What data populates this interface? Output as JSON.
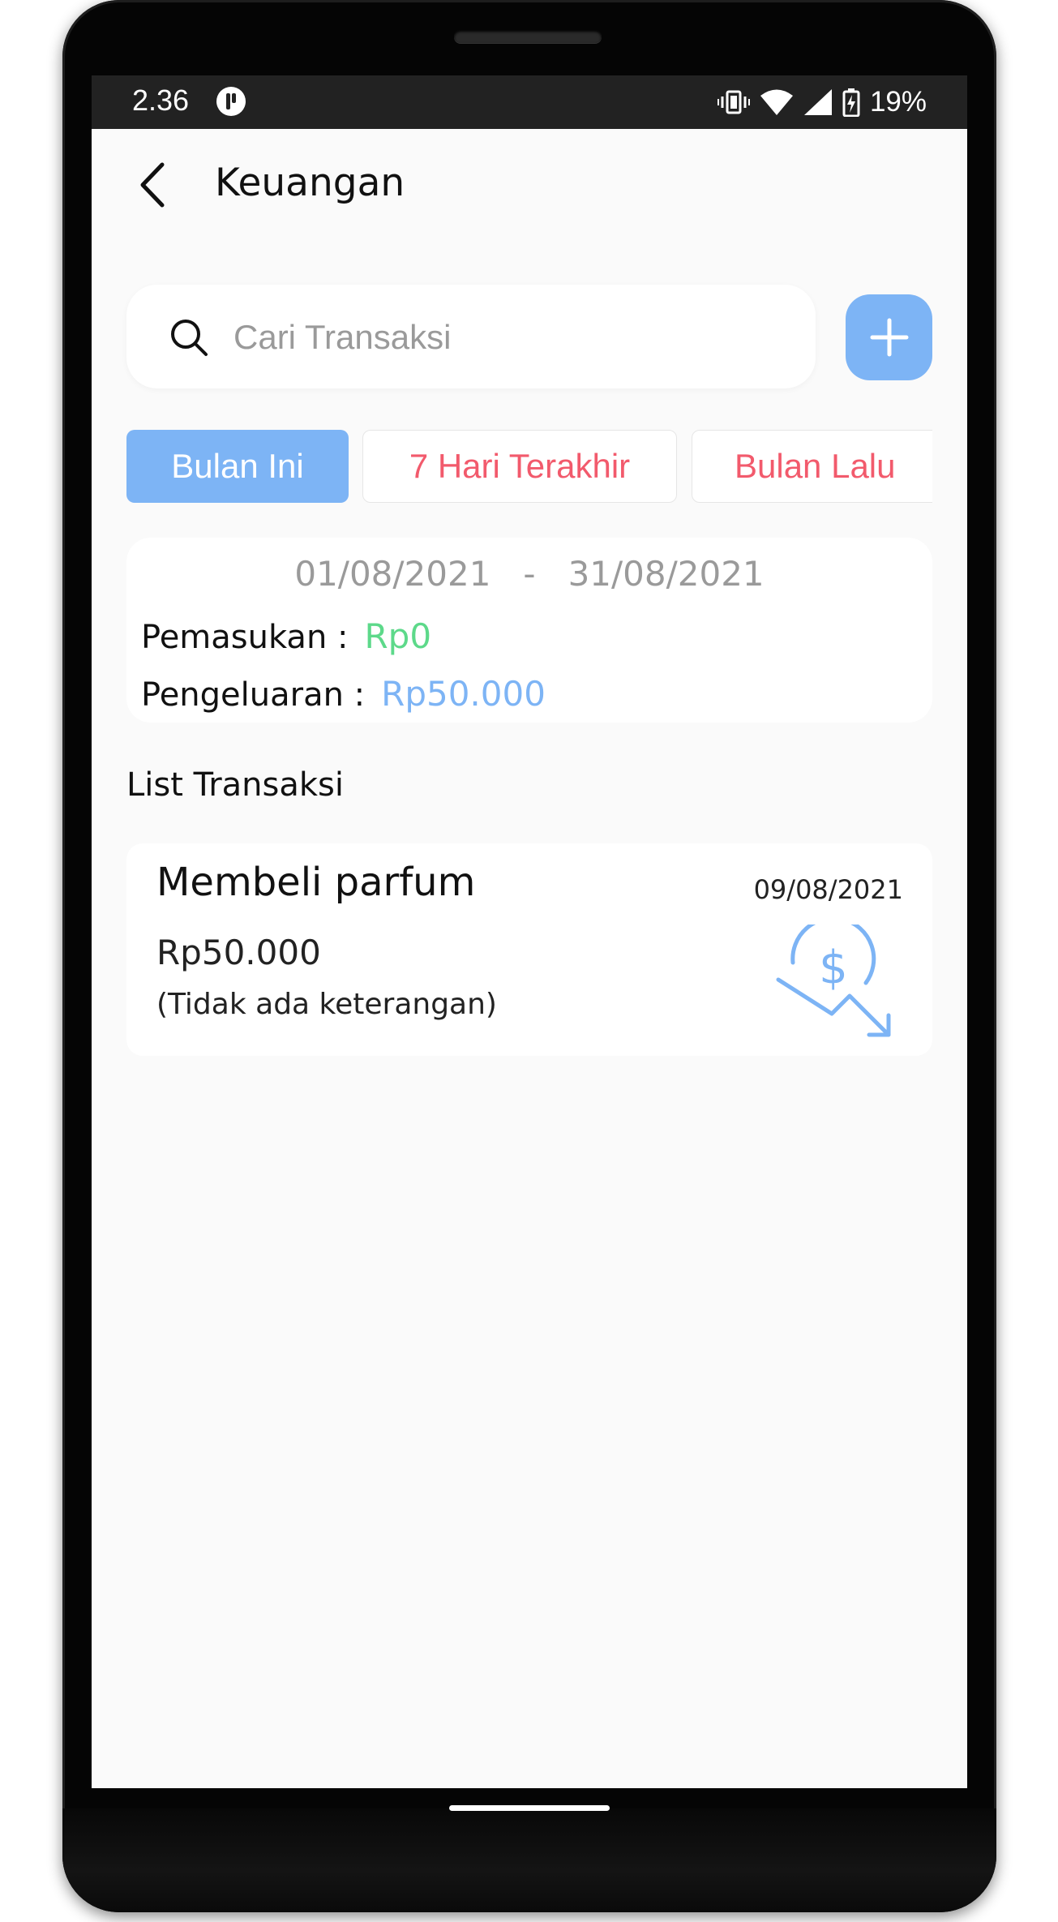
{
  "status_bar": {
    "time": "2.36",
    "battery": "19%"
  },
  "app_bar": {
    "title": "Keuangan"
  },
  "search": {
    "placeholder": "Cari Transaksi"
  },
  "filters": {
    "tabs": [
      {
        "label": "Bulan Ini",
        "active": true
      },
      {
        "label": "7 Hari Terakhir",
        "active": false
      },
      {
        "label": "Bulan Lalu",
        "active": false
      }
    ]
  },
  "summary": {
    "start_date": "01/08/2021",
    "separator": "-",
    "end_date": "31/08/2021",
    "income_label": "Pemasukan :",
    "income_value": "Rp0",
    "expense_label": "Pengeluaran :",
    "expense_value": "Rp50.000"
  },
  "list": {
    "title": "List Transaksi",
    "items": [
      {
        "title": "Membeli parfum",
        "date": "09/08/2021",
        "amount": "Rp50.000",
        "note": "(Tidak ada keterangan)",
        "icon": "expense-dollar-down-icon"
      }
    ]
  },
  "colors": {
    "accent_blue": "#7db4f5",
    "inactive_tab_text": "#f25a6c",
    "income_green": "#5dd98a",
    "screen_background": "#fafafa"
  }
}
